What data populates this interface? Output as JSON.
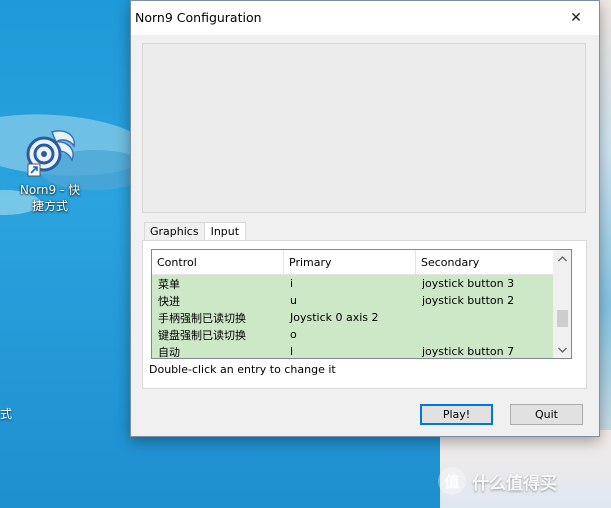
{
  "desktop": {
    "shortcut_label_line1": "Norn9 - 快",
    "shortcut_label_line2": "捷方式",
    "edge_char": "式",
    "watermark_logo": "值",
    "watermark_text": "什么值得买"
  },
  "window": {
    "title": "Norn9 Configuration",
    "close_glyph": "✕"
  },
  "tabs": [
    {
      "label": "Graphics",
      "active": false
    },
    {
      "label": "Input",
      "active": true
    }
  ],
  "table": {
    "headers": [
      "Control",
      "Primary",
      "Secondary"
    ],
    "rows": [
      [
        "菜单",
        "i",
        "joystick button 3"
      ],
      [
        "快进",
        "u",
        "joystick button 2"
      ],
      [
        "手柄强制已读切换",
        "Joystick 0 axis 2",
        ""
      ],
      [
        "键盘强制已读切换",
        "o",
        ""
      ],
      [
        "自动",
        "l",
        "joystick button 7"
      ]
    ]
  },
  "hint": "Double-click an entry to change it",
  "buttons": {
    "play": "Play!",
    "quit": "Quit"
  },
  "colors": {
    "row_highlight": "#cde8c6",
    "default_button_border": "#0078d7"
  }
}
